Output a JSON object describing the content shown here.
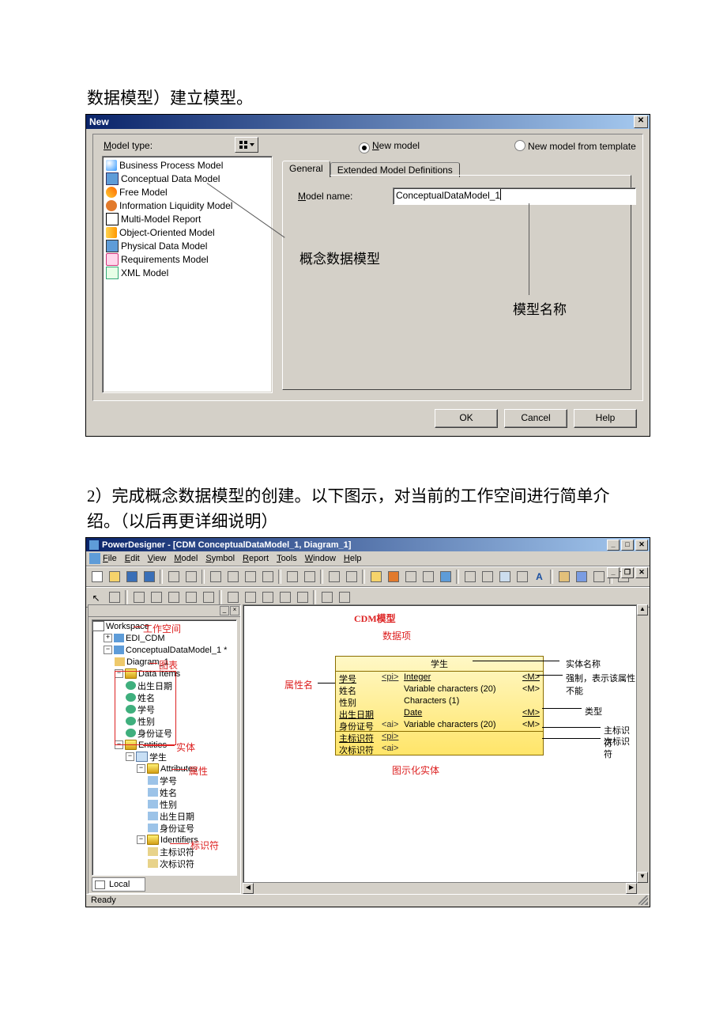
{
  "doc": {
    "intro_line": "数据模型）建立模型。",
    "step2": "2）完成概念数据模型的创建。以下图示，对当前的工作空间进行简单介绍。（以后再更详细说明）"
  },
  "dialog": {
    "title": "New",
    "model_type_label": "Model type:",
    "models": [
      "Business Process Model",
      "Conceptual Data Model",
      "Free Model",
      "Information Liquidity Model",
      "Multi-Model Report",
      "Object-Oriented Model",
      "Physical Data Model",
      "Requirements Model",
      "XML Model"
    ],
    "radio_new": "New model",
    "radio_tpl": "New model from template",
    "tab_general": "General",
    "tab_ext": "Extended Model Definitions",
    "model_name_label": "Model name:",
    "model_name_value": "ConceptualDataModel_1",
    "btn_ok": "OK",
    "btn_cancel": "Cancel",
    "btn_help": "Help",
    "annot_concept": "概念数据模型",
    "annot_name": "模型名称"
  },
  "app": {
    "title": "PowerDesigner - [CDM ConceptualDataModel_1, Diagram_1]",
    "menus": [
      "File",
      "Edit",
      "View",
      "Model",
      "Symbol",
      "Report",
      "Tools",
      "Window",
      "Help"
    ],
    "status": "Ready",
    "tree": {
      "workspace": "Workspace",
      "edi": "EDI_CDM",
      "cdm": "ConceptualDataModel_1 *",
      "diagram": "Diagram_1",
      "data_items_folder": "Data Items",
      "data_items": [
        "出生日期",
        "姓名",
        "学号",
        "性别",
        "身份证号"
      ],
      "entities_folder": "Entities",
      "entity_name": "学生",
      "attributes_folder": "Attributes",
      "attributes": [
        "学号",
        "姓名",
        "性别",
        "出生日期",
        "身份证号"
      ],
      "identifiers_folder": "Identifiers",
      "identifiers": [
        "主标识符",
        "次标识符"
      ],
      "local_tab": "Local"
    },
    "entity": {
      "title": "学生",
      "rows": [
        {
          "name": "学号",
          "pi": "<pi>",
          "type": "Integer",
          "m": "<M>"
        },
        {
          "name": "姓名",
          "pi": "",
          "type": "Variable characters (20)",
          "m": "<M>"
        },
        {
          "name": "性别",
          "pi": "",
          "type": "Characters (1)",
          "m": ""
        },
        {
          "name": "出生日期",
          "pi": "",
          "type": "Date",
          "m": "<M>"
        },
        {
          "name": "身份证号",
          "pi": "<ai>",
          "type": "Variable characters (20)",
          "m": "<M>"
        }
      ],
      "id1": {
        "name": "主标识符",
        "pi": "<pi>"
      },
      "id2": {
        "name": "次标识符",
        "pi": "<ai>"
      }
    },
    "ann": {
      "workspace": "工作空间",
      "cdm": "CDM模型",
      "data_item": "数据项",
      "diagram": "图表",
      "entity_folder": "实体",
      "attr": "属性",
      "ident": "标识符",
      "attr_name": "属性名",
      "entity_name": "实体名称",
      "mandatory": "强制，表示该属性不能",
      "type": "类型",
      "pi": "主标识符",
      "ai": "次标识符",
      "graphical": "图示化实体"
    }
  }
}
